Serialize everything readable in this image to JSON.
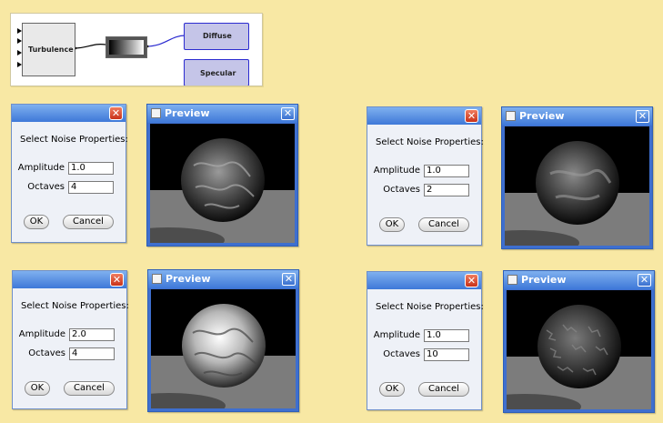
{
  "graph": {
    "turbulence_label": "Turbulence",
    "diffuse_label": "Diffuse",
    "specular_label": "Specular"
  },
  "panels": [
    {
      "dialog": {
        "prompt": "Select Noise Properties:",
        "amplitude_label": "Amplitude",
        "amplitude": "1.0",
        "octaves_label": "Octaves",
        "octaves": "4",
        "ok_label": "OK",
        "cancel_label": "Cancel",
        "close_glyph": "✕"
      },
      "preview": {
        "title": "Preview",
        "close_glyph": "✕"
      }
    },
    {
      "dialog": {
        "prompt": "Select Noise Properties:",
        "amplitude_label": "Amplitude",
        "amplitude": "1.0",
        "octaves_label": "Octaves",
        "octaves": "2",
        "ok_label": "OK",
        "cancel_label": "Cancel",
        "close_glyph": "✕"
      },
      "preview": {
        "title": "Preview",
        "close_glyph": "✕"
      }
    },
    {
      "dialog": {
        "prompt": "Select Noise Properties:",
        "amplitude_label": "Amplitude",
        "amplitude": "2.0",
        "octaves_label": "Octaves",
        "octaves": "4",
        "ok_label": "OK",
        "cancel_label": "Cancel",
        "close_glyph": "✕"
      },
      "preview": {
        "title": "Preview",
        "close_glyph": "✕"
      }
    },
    {
      "dialog": {
        "prompt": "Select Noise Properties:",
        "amplitude_label": "Amplitude",
        "amplitude": "1.0",
        "octaves_label": "Octaves",
        "octaves": "10",
        "ok_label": "OK",
        "cancel_label": "Cancel",
        "close_glyph": "✕"
      },
      "preview": {
        "title": "Preview",
        "close_glyph": "✕"
      }
    }
  ],
  "colors": {
    "background": "#f8e8a4",
    "titlebar": "#3e78d8",
    "close_red": "#c8321a",
    "link_blue": "#2b2bd0"
  }
}
